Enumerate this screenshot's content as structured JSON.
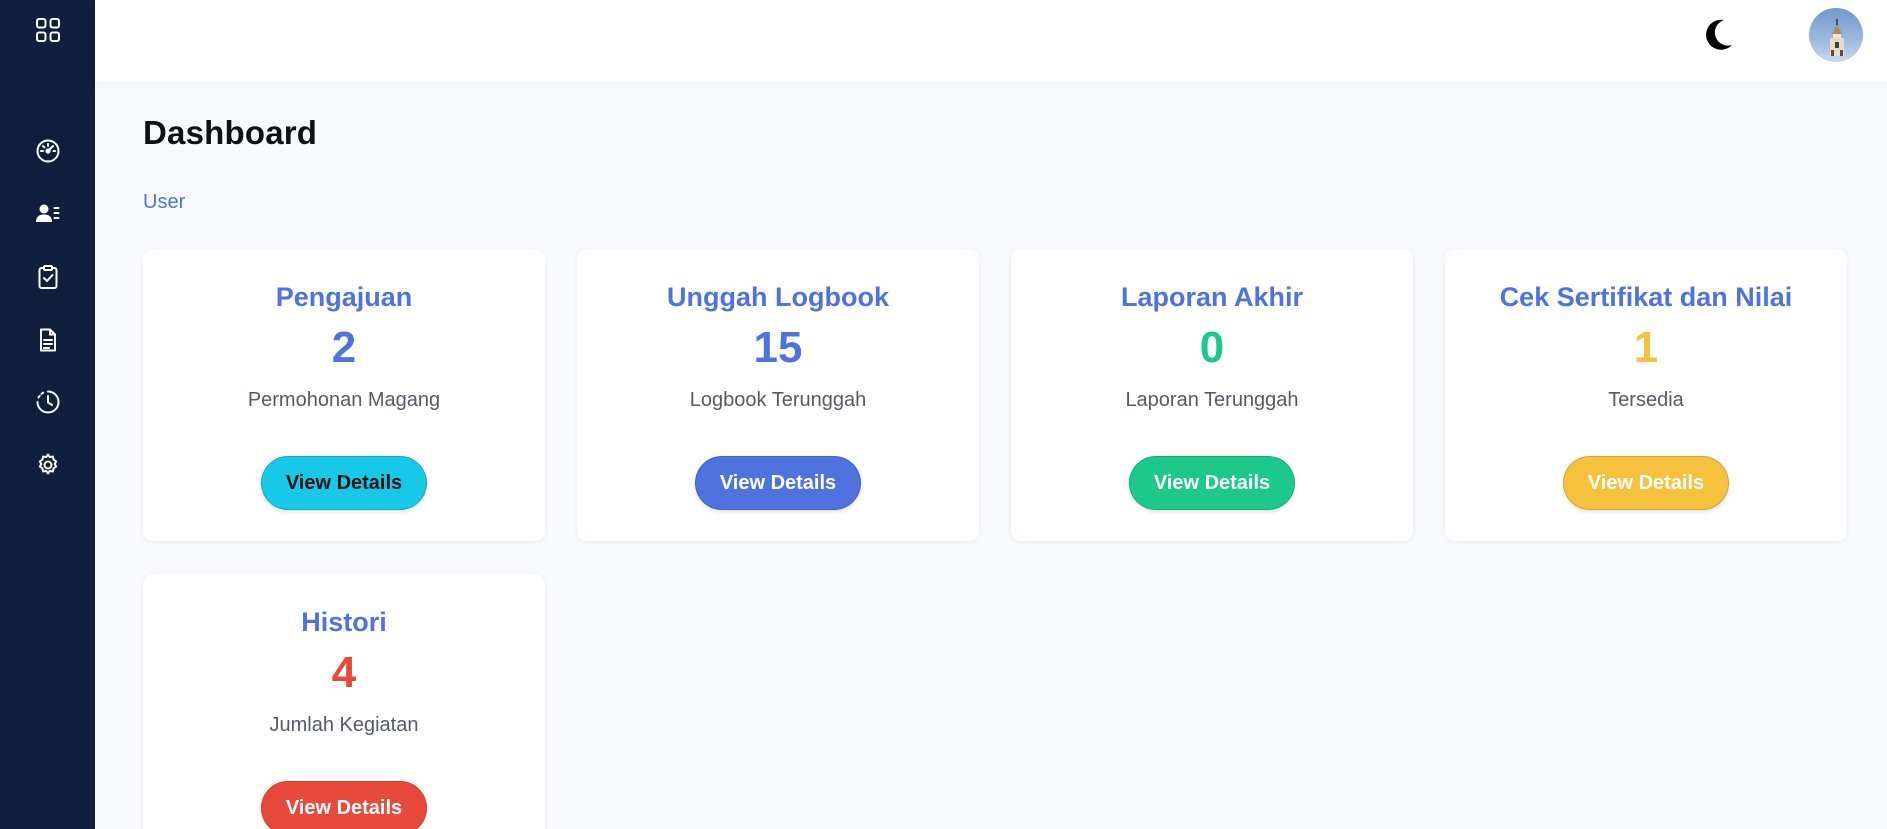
{
  "header": {
    "theme_toggle_icon": "moon-icon",
    "avatar_icon": "user-avatar"
  },
  "sidebar": {
    "items": [
      {
        "icon": "grid-menu-icon"
      },
      {
        "icon": "dashboard-gauge-icon"
      },
      {
        "icon": "user-list-icon"
      },
      {
        "icon": "clipboard-check-icon"
      },
      {
        "icon": "document-icon"
      },
      {
        "icon": "history-clock-icon"
      },
      {
        "icon": "gear-icon"
      }
    ]
  },
  "page": {
    "title": "Dashboard",
    "breadcrumb": "User"
  },
  "cards": [
    {
      "title": "Pengajuan",
      "value": "2",
      "subtitle": "Permohonan Magang",
      "button": "View Details",
      "value_color": "#4e73df",
      "button_bg": "#17c8e8",
      "button_text": "#111111"
    },
    {
      "title": "Unggah Logbook",
      "value": "15",
      "subtitle": "Logbook Terunggah",
      "button": "View Details",
      "value_color": "#4e73df",
      "button_bg": "#4e73df",
      "button_text": "#ffffff"
    },
    {
      "title": "Laporan Akhir",
      "value": "0",
      "subtitle": "Laporan Terunggah",
      "button": "View Details",
      "value_color": "#1cc88a",
      "button_bg": "#1cc88a",
      "button_text": "#ffffff"
    },
    {
      "title": "Cek Sertifikat dan Nilai",
      "value": "1",
      "subtitle": "Tersedia",
      "button": "View Details",
      "value_color": "#f6c23e",
      "button_bg": "#f6c23e",
      "button_text": "#ffffff"
    },
    {
      "title": "Histori",
      "value": "4",
      "subtitle": "Jumlah Kegiatan",
      "button": "View Details",
      "value_color": "#e74a3b",
      "button_bg": "#e74a3b",
      "button_text": "#ffffff"
    }
  ],
  "colors": {
    "sidebar_bg": "#0f1f3d",
    "accent": "#4e73df",
    "page_bg": "#f8f9fc"
  }
}
